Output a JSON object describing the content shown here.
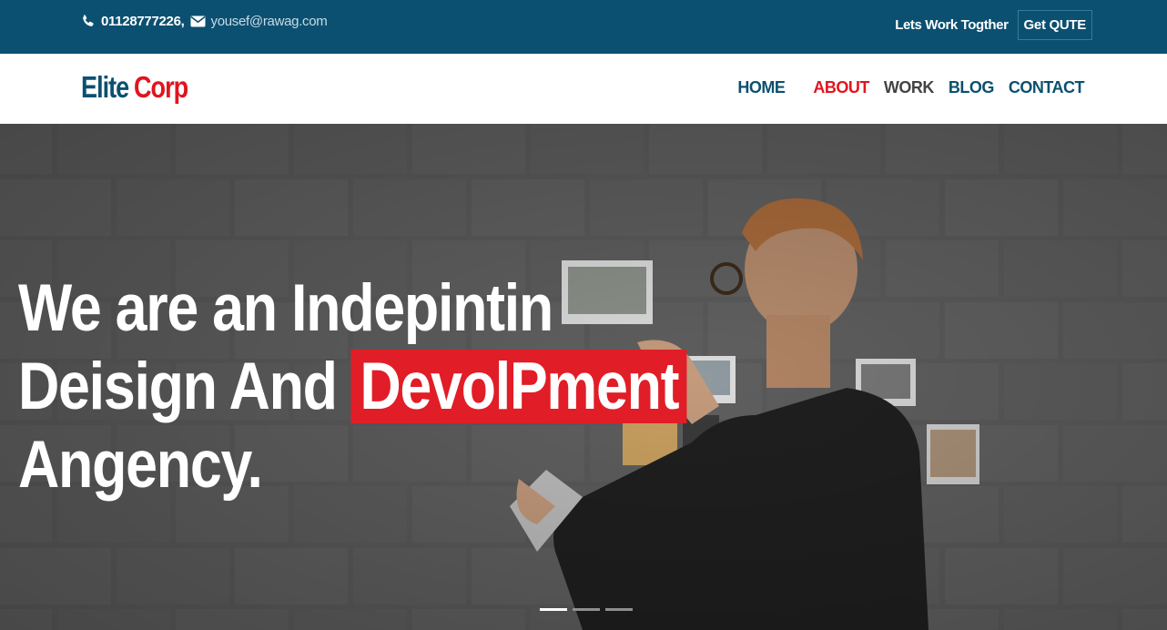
{
  "topbar": {
    "phone": "01128777226,",
    "email": "yousef@rawag.com",
    "work_text": "Lets Work Togther",
    "quote_button": "Get QUTE",
    "phone_icon": "phone-icon",
    "email_icon": "envelope-icon"
  },
  "brand": {
    "part1": "Elite",
    "part2": "Corp"
  },
  "nav": {
    "home": "HOME",
    "about": "ABOUT",
    "work": "WORK",
    "blog": "BLOG",
    "contact": "CONTACT"
  },
  "hero": {
    "line1": "We are an Indepintin",
    "line2_prefix": "Deisign And",
    "line2_highlight": "DevolPment",
    "line3": "Angency.",
    "slides_total": 3,
    "slide_active": 1
  },
  "colors": {
    "topbar_bg": "#0b5070",
    "accent_red": "#e0151f",
    "brand_blue": "#0b5070"
  }
}
